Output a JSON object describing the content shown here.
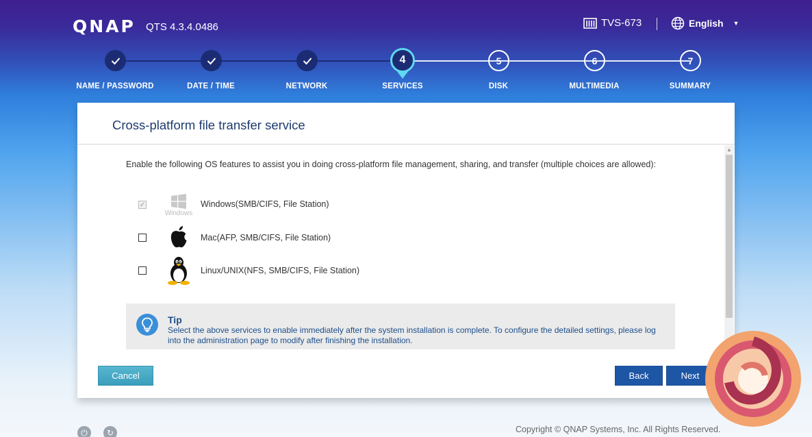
{
  "header": {
    "logo_text": "QNAP",
    "version": "QTS 4.3.4.0486",
    "model": "TVS-673",
    "language": "English"
  },
  "steps": [
    {
      "number": "1",
      "label": "NAME / PASSWORD",
      "status": "done"
    },
    {
      "number": "2",
      "label": "DATE / TIME",
      "status": "done"
    },
    {
      "number": "3",
      "label": "NETWORK",
      "status": "done"
    },
    {
      "number": "4",
      "label": "SERVICES",
      "status": "active"
    },
    {
      "number": "5",
      "label": "DISK",
      "status": "todo"
    },
    {
      "number": "6",
      "label": "MULTIMEDIA",
      "status": "todo"
    },
    {
      "number": "7",
      "label": "SUMMARY",
      "status": "todo"
    }
  ],
  "dialog": {
    "title": "Cross-platform file transfer service",
    "intro": "Enable the following OS features to assist you in doing cross-platform file management, sharing, and transfer (multiple choices are allowed):",
    "options": [
      {
        "label": "Windows(SMB/CIFS, File Station)",
        "checked": true,
        "disabled": true,
        "icon": "windows-icon",
        "icon_caption": "Windows"
      },
      {
        "label": "Mac(AFP, SMB/CIFS, File Station)",
        "checked": false,
        "disabled": false,
        "icon": "apple-icon"
      },
      {
        "label": "Linux/UNIX(NFS, SMB/CIFS, File Station)",
        "checked": false,
        "disabled": false,
        "icon": "linux-tux-icon"
      }
    ],
    "tip": {
      "title": "Tip",
      "text": "Select the above services to enable immediately after the system installation is complete. To configure the detailed settings, please log into the administration page to modify after finishing the installation."
    },
    "buttons": {
      "cancel": "Cancel",
      "back": "Back",
      "next": "Next"
    }
  },
  "footer": {
    "copyright": "Copyright © QNAP Systems, Inc. All Rights Reserved."
  },
  "colors": {
    "step_done": "#1c2c74",
    "step_active_ring": "#5fd8f0",
    "primary_button": "#1e56a6",
    "cancel_button": "#45a8c4",
    "title_text": "#1d3b6e"
  }
}
